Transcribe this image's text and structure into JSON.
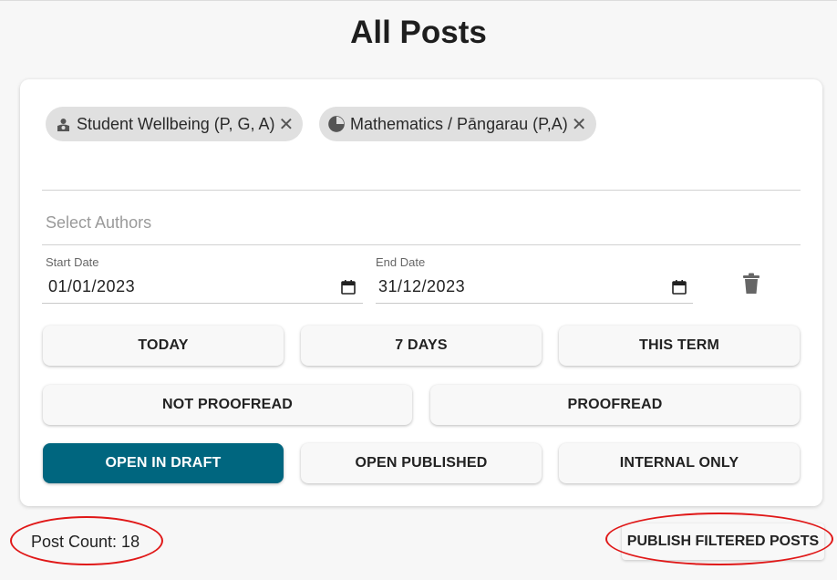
{
  "page": {
    "title": "All Posts"
  },
  "filters": {
    "subjects": [
      {
        "label": "Student Wellbeing (P, G, A)",
        "icon": "wellbeing-icon"
      },
      {
        "label": "Mathematics / Pāngarau (P,A)",
        "icon": "pie-chart-icon"
      }
    ],
    "chip_remove_glyph": "✕",
    "authors_placeholder": "Select Authors",
    "start_date": {
      "label": "Start Date",
      "value": "01/01/2023"
    },
    "end_date": {
      "label": "End Date",
      "value": "31/12/2023"
    }
  },
  "buttons": {
    "today": "TODAY",
    "seven_days": "7 DAYS",
    "this_term": "THIS TERM",
    "not_proofread": "NOT PROOFREAD",
    "proofread": "PROOFREAD",
    "open_in_draft": "OPEN IN DRAFT",
    "open_published": "OPEN PUBLISHED",
    "internal_only": "INTERNAL ONLY"
  },
  "footer": {
    "post_count": "Post Count: 18",
    "publish_button": "PUBLISH FILTERED POSTS"
  },
  "colors": {
    "accent": "#00667f",
    "highlight_ring": "#e01818",
    "chip_bg": "#e0e0e0"
  }
}
